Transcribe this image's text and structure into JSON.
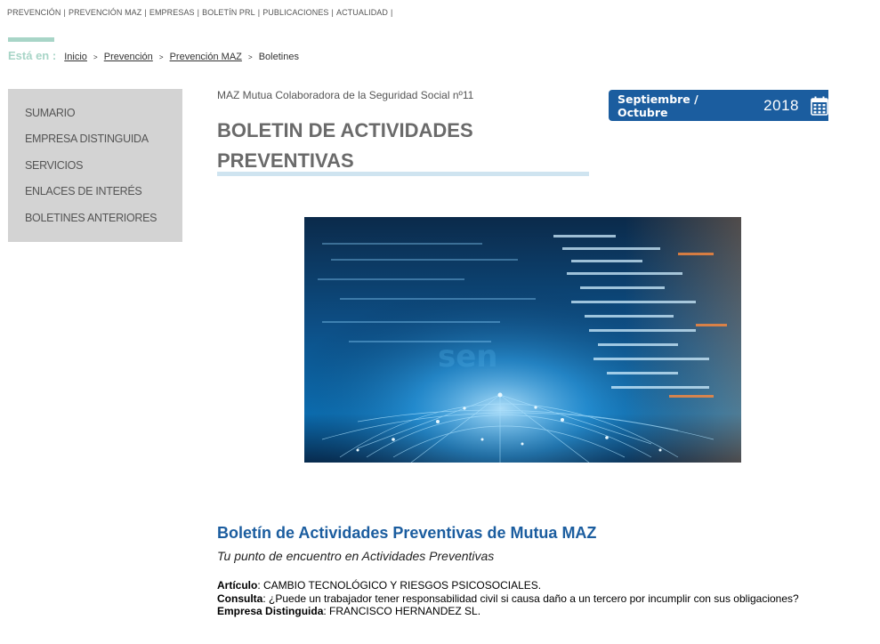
{
  "top_nav": [
    "PREVENCIÓN",
    "PREVENCIÓN MAZ",
    "EMPRESAS",
    "BOLETÍN PRL",
    "PUBLICACIONES",
    "ACTUALIDAD"
  ],
  "breadcrumb": {
    "label": "Está en :",
    "items": [
      "Inicio",
      "Prevención",
      "Prevención MAZ"
    ],
    "current": "Boletines"
  },
  "sidebar": {
    "items": [
      "SUMARIO",
      "EMPRESA DISTINGUIDA",
      "SERVICIOS",
      "ENLACES DE INTERÉS",
      "BOLETINES ANTERIORES"
    ]
  },
  "header": {
    "kicker": "MAZ Mutua Colaboradora de la Seguridad Social  nº11",
    "title_line1": "BOLETIN DE ACTIVIDADES",
    "title_line2": "PREVENTIVAS",
    "date_months": "Septiembre / Octubre",
    "date_year": "2018"
  },
  "main": {
    "heading": "Boletín de Actividades Preventivas de Mutua MAZ",
    "subheading": "Tu punto de encuentro en Actividades Preventivas",
    "items": [
      {
        "label": "Artículo",
        "text": ": CAMBIO TECNOLÓGICO Y RIESGOS PSICOSOCIALES."
      },
      {
        "label": "Consulta",
        "text": ": ¿Puede un trabajador tener responsabilidad civil si causa daño a un tercero por incumplir con sus obligaciones?"
      },
      {
        "label": "Empresa Distinguida",
        "text": ": FRANCISCO HERNANDEZ SL."
      }
    ]
  },
  "icons": {
    "calendar": "calendar-icon",
    "breadcrumb_separator": "chevron-right-icon"
  },
  "colors": {
    "brand_blue": "#1b5d9f",
    "accent_green": "#a8d5c7",
    "sidebar_bg": "#d3d3d3",
    "title_underline": "#cfe4f0"
  }
}
